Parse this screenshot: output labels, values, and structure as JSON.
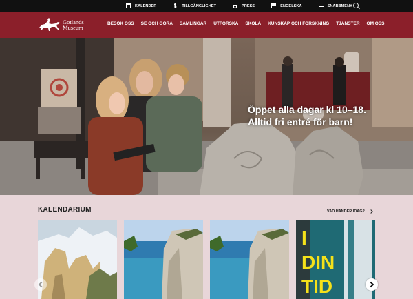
{
  "utility_nav": {
    "items": [
      {
        "label": "KALENDER",
        "icon": "calendar-icon"
      },
      {
        "label": "TILLGÄNGLIGHET",
        "icon": "accessibility-icon"
      },
      {
        "label": "PRESS",
        "icon": "camera-icon"
      },
      {
        "label": "ENGELSKA",
        "icon": "flag-icon"
      },
      {
        "label": "SNABBMENY",
        "icon": "plus-icon"
      }
    ],
    "search_icon": "search-icon"
  },
  "brand": {
    "line1": "Gotlands",
    "line2": "Museum",
    "color": "#8b1f2a"
  },
  "main_nav": {
    "items": [
      "BESÖK OSS",
      "SE OCH GÖRA",
      "SAMLINGAR",
      "UTFORSKA",
      "SKOLA",
      "KUNSKAP OCH FORSKNING",
      "TJÄNSTER",
      "OM OSS"
    ]
  },
  "hero": {
    "line1": "Öppet alla dagar kl 10–18.",
    "line2": "Alltid fri entré för barn!"
  },
  "calendar": {
    "title": "KALENDARIUM",
    "link": "VAD HÄNDER IDAG?",
    "card4_text": [
      "I",
      "DIN",
      "TID"
    ],
    "prev_icon": "chevron-left-icon",
    "next_icon": "chevron-right-icon"
  }
}
